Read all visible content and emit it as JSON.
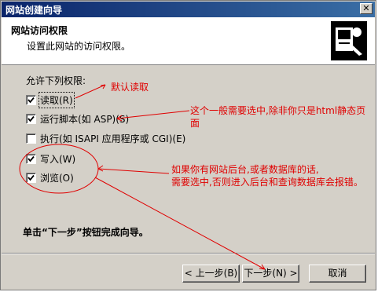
{
  "window": {
    "title": "网站创建向导",
    "close_glyph": "✕"
  },
  "header": {
    "heading": "网站访问权限",
    "subheading": "设置此网站的访问权限。"
  },
  "permissions": {
    "label": "允许下列权限:",
    "items": [
      {
        "label": "读取(R)",
        "checked": true
      },
      {
        "label": "运行脚本(如 ASP)(S)",
        "checked": true
      },
      {
        "label": "执行(如 ISAPI 应用程序或 CGI)(E)",
        "checked": false
      },
      {
        "label": "写入(W)",
        "checked": true
      },
      {
        "label": "浏览(O)",
        "checked": true
      }
    ]
  },
  "finish_text": "单击“下一步”按钮完成向导。",
  "buttons": {
    "back": "< 上一步(B)",
    "next": "下一步(N) >",
    "cancel": "取消"
  },
  "annotations": {
    "default_read": "默认读取",
    "script_note_1": "这个一般需要选中,除非你只是html静态页",
    "script_note_2": "面",
    "write_note_1": "如果你有网站后台,或者数据库的话,",
    "write_note_2": "需要选中,否则进入后台和查询数据库会报错。"
  },
  "colors": {
    "annotation": "#e00000",
    "titlebar": "#0a246a"
  }
}
